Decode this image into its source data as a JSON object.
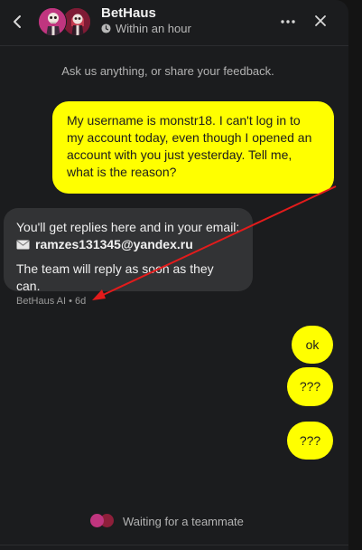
{
  "header": {
    "back_icon": "chevron-left-icon",
    "title": "BetHaus",
    "status": "Within an hour",
    "status_icon": "clock-icon",
    "more_icon": "more-horizontal-icon",
    "close_icon": "close-icon"
  },
  "conversation": {
    "intro": "Ask us anything, or share your feedback.",
    "messages": [
      {
        "from": "user",
        "text": "My username is monstr18. I can't log in to my account today, even though I opened an account with you just yesterday. Tell me, what is the reason?"
      },
      {
        "from": "bot",
        "line1": "You'll get replies here and in your email:",
        "email": "ramzes131345@yandex.ru",
        "line3": "The team will reply as soon as they can."
      },
      {
        "from": "user",
        "text": "ok"
      },
      {
        "from": "user",
        "text": "???"
      },
      {
        "from": "user",
        "text": "???"
      }
    ],
    "bot_meta": "BetHaus AI • 6d"
  },
  "footer": {
    "waiting": "Waiting for a teammate"
  },
  "colors": {
    "user_bubble": "#ffff00",
    "bot_bubble": "#323335",
    "panel": "#1b1c1e",
    "annotation_arrow": "#e31b1b"
  }
}
